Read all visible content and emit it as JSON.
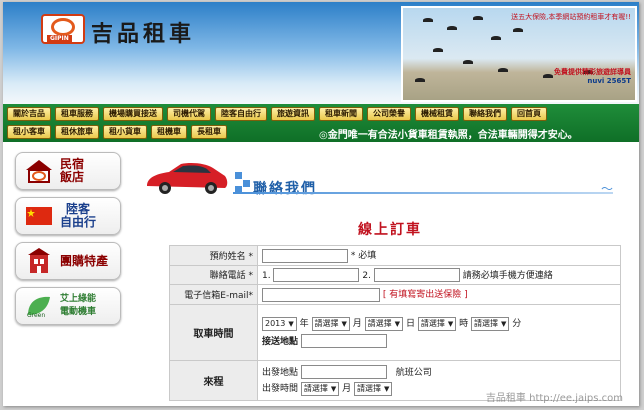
{
  "header": {
    "brand_logo": "GIPIN",
    "site_title": "吉品租車",
    "ad_line1": "送五大保險,本季網站預約租車才有喔!!",
    "ad_line2": "免費提供精彩旅遊詳導員",
    "ad_model": "nuvi 2565T"
  },
  "nav": {
    "row1": [
      "關於吉品",
      "租車服務",
      "機場購買接送",
      "司機代駕",
      "陸客自由行",
      "旅遊資訊",
      "租車新聞",
      "公司榮譽",
      "機械租賃",
      "聯絡我們",
      "回首頁"
    ],
    "row2": [
      "租小客車",
      "租休旅車",
      "租小貨車",
      "租機車",
      "長租車"
    ],
    "marquee": "◎金門唯一有合法小貨車租賃執照，合法車輛開得才安心。"
  },
  "sidebar": {
    "items": [
      {
        "label": "民宿\n飯店",
        "icon": "house-logo-icon"
      },
      {
        "label": "陸客\n自由行",
        "icon": "china-flag-icon"
      },
      {
        "label": "團購特產",
        "icon": "building-icon"
      },
      {
        "label": "艾上綠能\n電動機車",
        "icon": "green-leaf-icon",
        "logo_text": "Green"
      }
    ]
  },
  "content": {
    "section_title": "聯絡我們",
    "form_title": "線上訂車",
    "form": {
      "name_label": "預約姓名 *",
      "required_note": "* 必填",
      "phone_label": "聯絡電話 *",
      "phone1_prefix": "1.",
      "phone2_prefix": "2.",
      "phone_note": "請務必填手機方便連絡",
      "email_label": "電子信箱E-mail*",
      "email_note_open": "[",
      "email_note": "有填寫寄出送保險",
      "email_note_close": "]",
      "pickup_label": "取車時間",
      "year_value": "2013",
      "unit_year": "年",
      "select_placeholder": "請選擇",
      "unit_month": "月",
      "unit_day": "日",
      "unit_hour": "時",
      "unit_minute": "分",
      "pickup_place_label": "接送地點",
      "arrival_label": "來程",
      "depart_place_label": "出發地點",
      "airline_label": "航班公司",
      "depart_time_label": "出發時間"
    },
    "watermark": "吉品租車 http://ee.jaips.com"
  },
  "colors": {
    "nav_green": "#0f6f27",
    "title_red": "#c1121f",
    "title_blue": "#1f5fa8"
  }
}
